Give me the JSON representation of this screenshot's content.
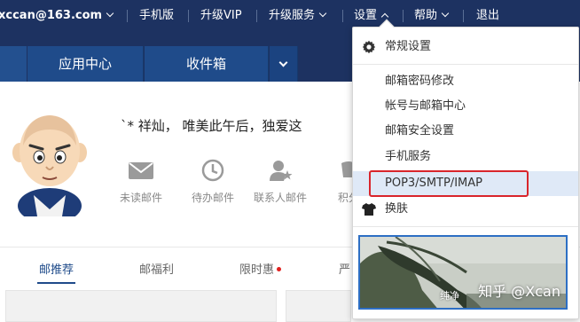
{
  "topbar": {
    "account": "xccan@163.com",
    "mobile": "手机版",
    "vip": "升级VIP",
    "upgrade_service": "升级服务",
    "settings": "设置",
    "help": "帮助",
    "logout": "退出"
  },
  "navbar": {
    "tabs": [
      {
        "label": "应用中心"
      },
      {
        "label": "收件箱"
      }
    ]
  },
  "profile": {
    "greeting": "ˋ*   祥灿， 唯美此午后，独爱这"
  },
  "quick_items": [
    {
      "label": "未读邮件",
      "icon": "mail-icon"
    },
    {
      "label": "待办邮件",
      "icon": "clock-icon"
    },
    {
      "label": "联系人邮件",
      "icon": "contact-star-icon"
    },
    {
      "label": "积分",
      "icon": "points-icon"
    }
  ],
  "content_tabs": [
    {
      "label": "邮推荐",
      "active": true
    },
    {
      "label": "邮福利"
    },
    {
      "label": "限时惠",
      "badge": "red-dot"
    },
    {
      "label": "严"
    }
  ],
  "settings_menu": {
    "header": "常规设置",
    "items": [
      {
        "label": "邮箱密码修改"
      },
      {
        "label": "帐号与邮箱中心"
      },
      {
        "label": "邮箱安全设置"
      },
      {
        "label": "手机服务"
      },
      {
        "label": "POP3/SMTP/IMAP",
        "highlighted": true
      }
    ],
    "skin_label": "换肤",
    "skin_preview_caption": "纯净",
    "watermark": "知乎 @Xcan"
  },
  "colors": {
    "topbar_bg": "#1d3261",
    "nav_tab_bg": "#1f4b8a",
    "highlight_border": "#d9252b",
    "hover_row": "#dfe9f7"
  }
}
